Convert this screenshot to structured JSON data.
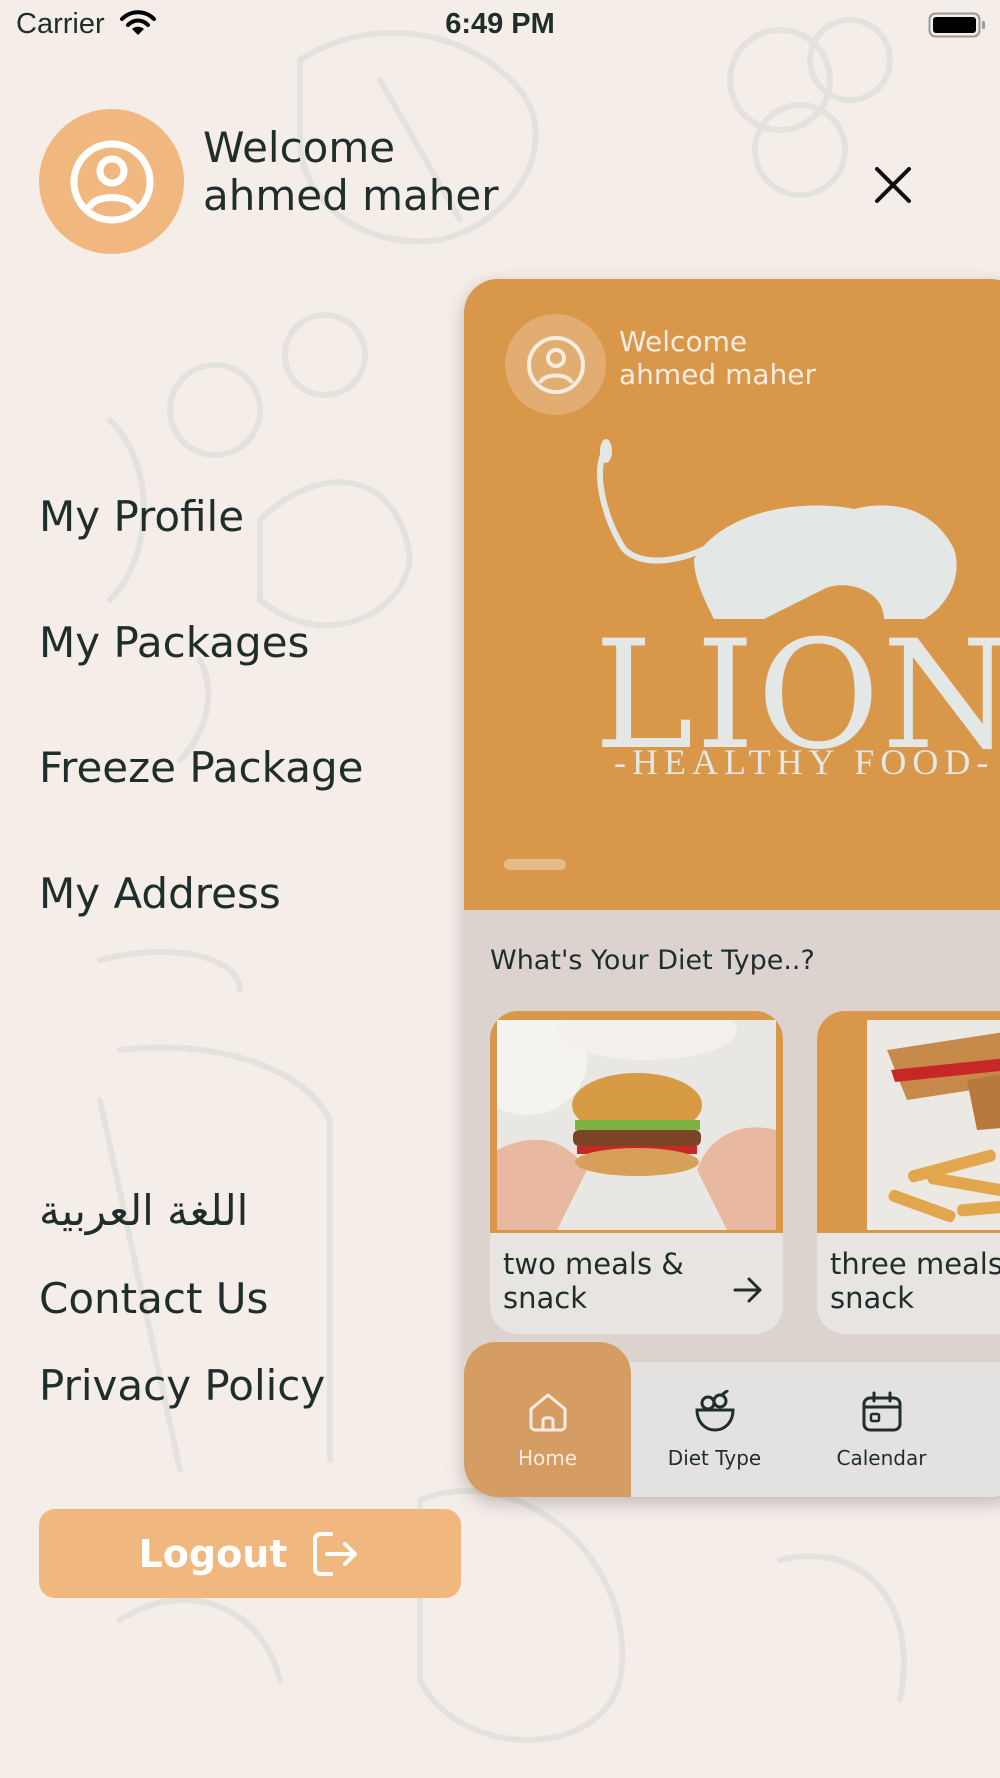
{
  "status_bar": {
    "carrier": "Carrier",
    "time": "6:49 PM"
  },
  "header": {
    "welcome_line1": "Welcome",
    "welcome_line2": "ahmed maher"
  },
  "menu": {
    "items": [
      {
        "label": "My Profile"
      },
      {
        "label": "My Packages"
      },
      {
        "label": "Freeze Package"
      },
      {
        "label": "My Address"
      }
    ],
    "secondary": [
      {
        "label": "اللغة العربية"
      },
      {
        "label": "Contact Us"
      },
      {
        "label": "Privacy Policy"
      }
    ]
  },
  "logout": {
    "label": "Logout"
  },
  "preview": {
    "welcome_line1": "Welcome",
    "welcome_line2": "ahmed maher",
    "logo_title": "LIONS",
    "logo_subtitle": "-HEALTHY FOOD-",
    "diet_heading": "What's Your Diet Type..?",
    "diet_cards": [
      {
        "label_line1": "two meals &",
        "label_line2": "snack"
      },
      {
        "label_line1": "three meals",
        "label_line2": "snack"
      }
    ],
    "nav": [
      {
        "label": "Home",
        "icon": "home-icon"
      },
      {
        "label": "Diet Type",
        "icon": "salad-bowl-icon"
      },
      {
        "label": "Calendar",
        "icon": "calendar-icon"
      }
    ]
  },
  "colors": {
    "background": "#f5ede8",
    "accent": "#f0b77e",
    "banner": "#d9974a",
    "text": "#1f2e2b"
  }
}
